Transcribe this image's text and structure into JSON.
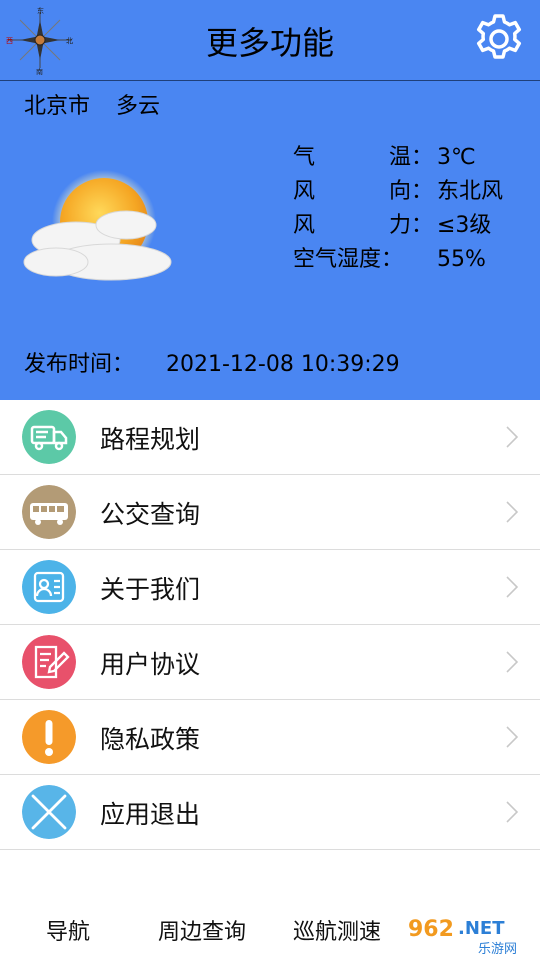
{
  "header": {
    "title": "更多功能",
    "city": "北京市",
    "weather": "多云",
    "stats": [
      {
        "label_chars": [
          "气",
          "温："
        ],
        "value": "3℃"
      },
      {
        "label_chars": [
          "风",
          "向："
        ],
        "value": "东北风"
      },
      {
        "label_chars": [
          "风",
          "力："
        ],
        "value": "≤3级"
      },
      {
        "label_chars": [
          "空气湿度："
        ],
        "value": "55%"
      }
    ],
    "publish_label": "发布时间：",
    "publish_time": "2021-12-08 10:39:29",
    "compass_labels": {
      "n": "东",
      "e": "北",
      "s": "南",
      "w": "西"
    }
  },
  "menu": [
    {
      "label": "路程规划",
      "icon": "truck-icon",
      "color": "#5cc9a7"
    },
    {
      "label": "公交查询",
      "icon": "bus-icon",
      "color": "#b39b76"
    },
    {
      "label": "关于我们",
      "icon": "profile-card-icon",
      "color": "#4cb3e8"
    },
    {
      "label": "用户协议",
      "icon": "edit-document-icon",
      "color": "#e8516b"
    },
    {
      "label": "隐私政策",
      "icon": "exclamation-icon",
      "color": "#f59a2a"
    },
    {
      "label": "应用退出",
      "icon": "close-x-icon",
      "color": "#58b5e8"
    }
  ],
  "nav": {
    "tabs": [
      "导航",
      "周边查询",
      "巡航测速"
    ]
  },
  "watermark": {
    "text": "962.NET",
    "sub": "乐游网"
  },
  "colors": {
    "header_bg": "#4a86f2",
    "divider": "#dcdcdc"
  }
}
